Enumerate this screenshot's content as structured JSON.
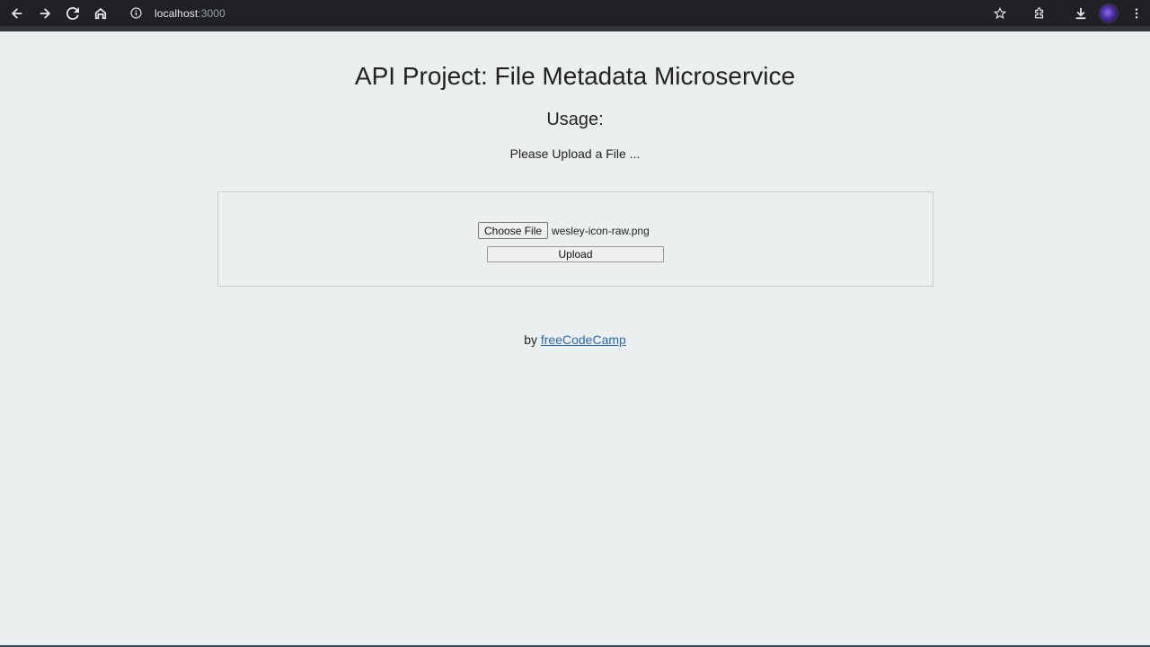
{
  "browser": {
    "url_host": "localhost",
    "url_port": ":3000",
    "icons": [
      "back-icon",
      "forward-icon",
      "reload-icon",
      "home-icon",
      "site-info-icon",
      "bookmark-star-icon",
      "extensions-icon",
      "download-icon",
      "profile-avatar",
      "menu-icon"
    ]
  },
  "page": {
    "title": "API Project: File Metadata Microservice",
    "usage_heading": "Usage:",
    "instruction": "Please Upload a File ...",
    "choose_file_label": "Choose File",
    "selected_file": "wesley-icon-raw.png",
    "upload_label": "Upload",
    "footer_by": "by",
    "footer_link": "freeCodeCamp"
  },
  "colors": {
    "page_background": "#eceff0",
    "chrome_background": "#202124",
    "link": "#2a6ca8"
  }
}
